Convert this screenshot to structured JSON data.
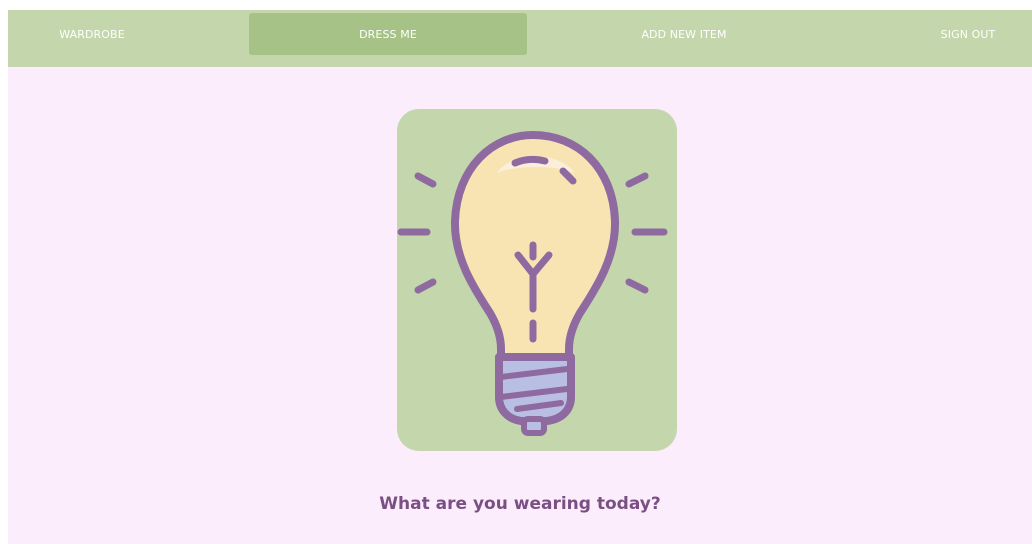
{
  "nav": {
    "items": [
      {
        "label": "WARDROBE"
      },
      {
        "label": "DRESS ME"
      },
      {
        "label": "ADD NEW ITEM"
      },
      {
        "label": "SIGN OUT"
      }
    ],
    "active": "DRESS ME"
  },
  "hero": {
    "icon": "lightbulb-icon"
  },
  "main": {
    "question": "What are you wearing today?"
  },
  "colors": {
    "page_background": "#fcedfd",
    "nav_background": "#c4d6ab",
    "nav_active": "#a6c286",
    "hero_background": "#c4d6ab",
    "bulb_glass": "#f8e4b2",
    "bulb_outline": "#8e6aa0",
    "bulb_base": "#b9bfe2",
    "text_accent": "#7a5084"
  }
}
